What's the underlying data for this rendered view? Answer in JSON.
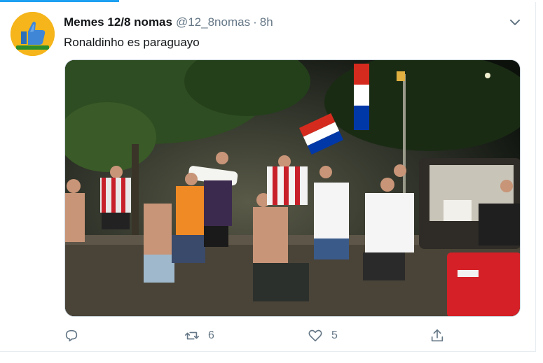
{
  "tweet": {
    "display_name": "Memes 12/8 nomas",
    "handle": "@12_8nomas",
    "separator": "·",
    "time": "8h",
    "text": "Ronaldinho es paraguayo",
    "avatar_caption": "Memes 12/8"
  },
  "actions": {
    "reply_count": "",
    "retweet_count": "6",
    "like_count": "5"
  },
  "colors": {
    "accent": "#1da1f2",
    "secondary_text": "#657786",
    "avatar_bg": "#f5b51b"
  },
  "icons": [
    "thumbs-up-icon",
    "chevron-down-icon",
    "reply-icon",
    "retweet-icon",
    "like-icon",
    "share-icon"
  ]
}
